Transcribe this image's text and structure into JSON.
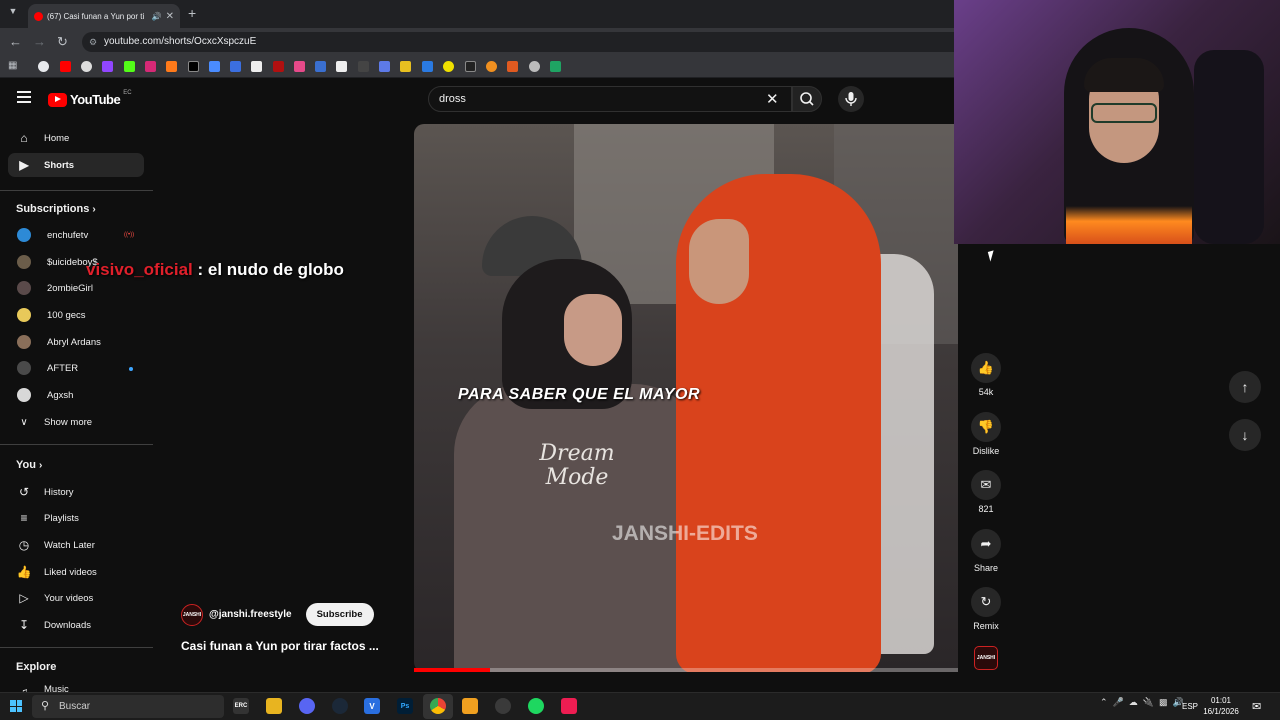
{
  "browser": {
    "tab_title": "(67) Casi funan a Yun por ti",
    "url": "youtube.com/shorts/OcxcXspczuE"
  },
  "youtube": {
    "logo_text": "YouTube",
    "country_code": "EC",
    "search_query": "dross"
  },
  "sidebar": {
    "primary": [
      {
        "label": "Home",
        "icon": "home-icon"
      },
      {
        "label": "Shorts",
        "icon": "shorts-icon",
        "active": true
      }
    ],
    "subscriptions_title": "Subscriptions",
    "subscriptions": [
      {
        "label": "enchufetv",
        "avatar_color": "#2d8ad6",
        "badge": "live"
      },
      {
        "label": "$uicideboy$",
        "avatar_color": "#6b5d4a"
      },
      {
        "label": "2ombieGirl",
        "avatar_color": "#5a4a4a"
      },
      {
        "label": "100 gecs",
        "avatar_color": "#e8c95a"
      },
      {
        "label": "Abryl Ardans",
        "avatar_color": "#8a6f5a"
      },
      {
        "label": "AFTER",
        "avatar_color": "#4a4a4a",
        "badge": "new"
      },
      {
        "label": "Agxsh",
        "avatar_color": "#d8d8d8"
      }
    ],
    "show_more": "Show more",
    "you_title": "You",
    "you_items": [
      {
        "label": "History",
        "icon": "history-icon"
      },
      {
        "label": "Playlists",
        "icon": "playlists-icon"
      },
      {
        "label": "Watch Later",
        "icon": "watch-later-icon"
      },
      {
        "label": "Liked videos",
        "icon": "liked-icon"
      },
      {
        "label": "Your videos",
        "icon": "your-videos-icon"
      },
      {
        "label": "Downloads",
        "icon": "downloads-icon"
      }
    ],
    "explore_title": "Explore",
    "explore_items": [
      {
        "label": "Music",
        "icon": "music-icon"
      }
    ]
  },
  "stream_overlay": {
    "username": "visivo_oficial",
    "message": ": el nudo de globo"
  },
  "short": {
    "caption": "PARA SABER QUE EL MAYOR",
    "watermark": "JANSHI-EDITS",
    "print_text": "Dream Mode",
    "progress": 0.14,
    "channel": "@janshi.freestyle",
    "channel_avatar_text": "JANSHI",
    "subscribe_label": "Subscribe",
    "title": "Casi funan a Yun por tirar factos ..."
  },
  "actions": [
    {
      "label": "54k",
      "icon": "like-icon"
    },
    {
      "label": "Dislike",
      "icon": "dislike-icon"
    },
    {
      "label": "821",
      "icon": "comment-icon"
    },
    {
      "label": "Share",
      "icon": "share-icon"
    },
    {
      "label": "Remix",
      "icon": "remix-icon"
    }
  ],
  "taskbar": {
    "search_placeholder": "Buscar",
    "language": "ESP",
    "time": "01:01",
    "date": "16/1/2026"
  }
}
